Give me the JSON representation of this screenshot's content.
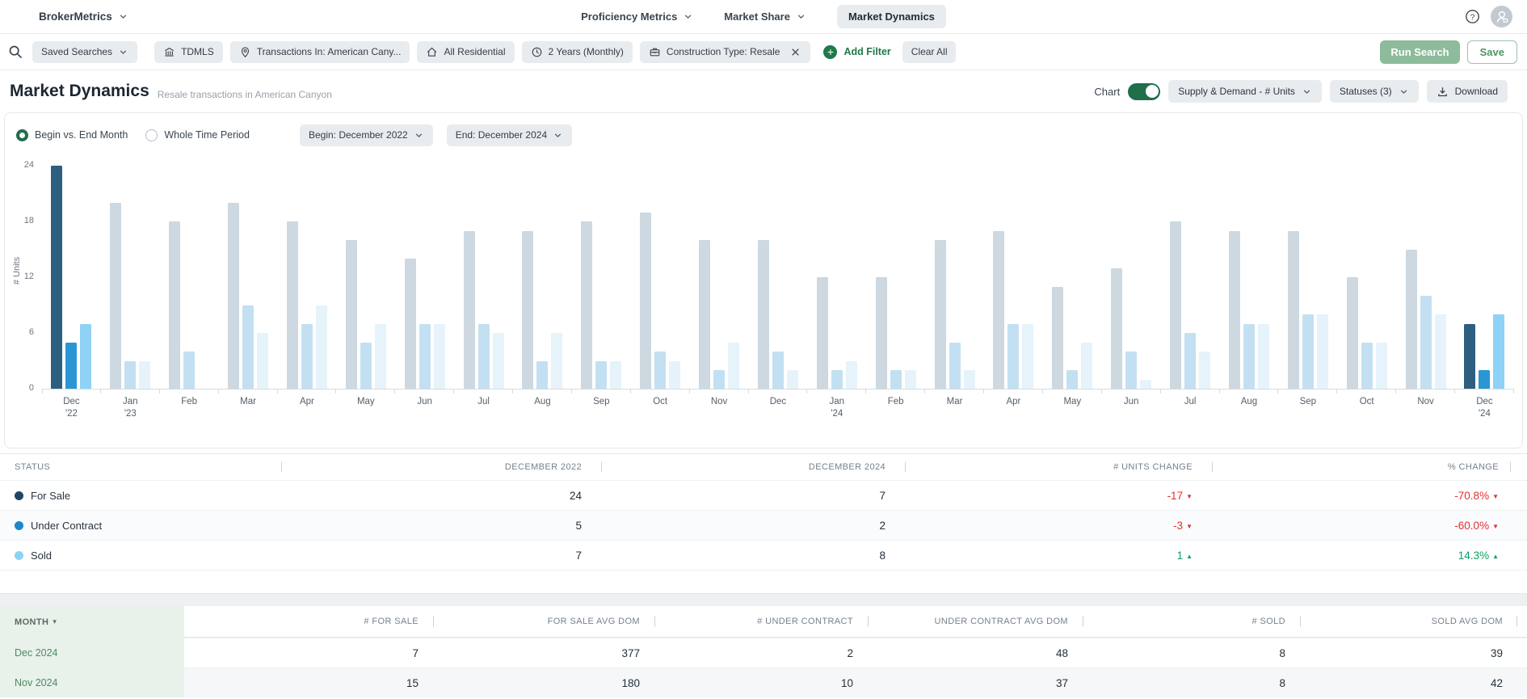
{
  "colors": {
    "accent_green": "#1f6f4a",
    "negative_red": "#e03131",
    "positive_green": "#0a9f63",
    "bar_for_sale": "#2d5f80",
    "bar_under_contract": "#2a96d3",
    "bar_sold": "#8ed2f7",
    "bar_for_sale_muted": "#cdd8e0",
    "bar_under_contract_muted": "#c3e0f2",
    "bar_sold_muted": "#e6f3fb"
  },
  "nav": {
    "brand": "BrokerMetrics",
    "menu_proficiency": "Proficiency Metrics",
    "menu_market_share": "Market Share",
    "tab_market_dynamics": "Market Dynamics"
  },
  "filter_bar": {
    "chips": [
      {
        "label": "Saved Searches",
        "icon": null,
        "chevron": true,
        "closable": false
      },
      {
        "label": "TDMLS",
        "icon": "bank-icon",
        "chevron": false,
        "closable": false
      },
      {
        "label": "Transactions In: American Cany...",
        "icon": "location-pin-icon",
        "chevron": false,
        "closable": false
      },
      {
        "label": "All Residential",
        "icon": "home-icon",
        "chevron": false,
        "closable": false
      },
      {
        "label": "2 Years (Monthly)",
        "icon": "clock-icon",
        "chevron": false,
        "closable": false
      },
      {
        "label": "Construction Type: Resale",
        "icon": "construction-type-icon",
        "chevron": false,
        "closable": true
      }
    ],
    "add_filter_label": "Add Filter",
    "clear_all_label": "Clear All",
    "run_search_label": "Run Search",
    "save_label": "Save"
  },
  "header": {
    "title": "Market Dynamics",
    "subtitle": "Resale transactions in American Canyon",
    "chart_toggle_label": "Chart",
    "metric_dropdown": "Supply & Demand - # Units",
    "statuses_dropdown": "Statuses (3)",
    "download_label": "Download"
  },
  "controls": {
    "radio_begin_end": "Begin vs. End Month",
    "radio_whole": "Whole Time Period",
    "begin_dropdown": "Begin: December 2022",
    "end_dropdown": "End: December 2024"
  },
  "chart_data": {
    "type": "bar",
    "title": "Supply & Demand - # Units",
    "xlabel": "",
    "ylabel": "# Units",
    "ylim": [
      0,
      24
    ],
    "yticks": [
      0,
      6,
      12,
      18,
      24
    ],
    "grid": false,
    "legend_position": "none",
    "categories": [
      [
        "Dec",
        "'22"
      ],
      [
        "Jan",
        "'23"
      ],
      [
        "Feb",
        ""
      ],
      [
        "Mar",
        ""
      ],
      [
        "Apr",
        ""
      ],
      [
        "May",
        ""
      ],
      [
        "Jun",
        ""
      ],
      [
        "Jul",
        ""
      ],
      [
        "Aug",
        ""
      ],
      [
        "Sep",
        ""
      ],
      [
        "Oct",
        ""
      ],
      [
        "Nov",
        ""
      ],
      [
        "Dec",
        ""
      ],
      [
        "Jan",
        "'24"
      ],
      [
        "Feb",
        ""
      ],
      [
        "Mar",
        ""
      ],
      [
        "Apr",
        ""
      ],
      [
        "May",
        ""
      ],
      [
        "Jun",
        ""
      ],
      [
        "Jul",
        ""
      ],
      [
        "Aug",
        ""
      ],
      [
        "Sep",
        ""
      ],
      [
        "Oct",
        ""
      ],
      [
        "Nov",
        ""
      ],
      [
        "Dec",
        "'24"
      ]
    ],
    "series": [
      {
        "name": "For Sale",
        "values": [
          24,
          20,
          18,
          20,
          18,
          16,
          14,
          17,
          17,
          18,
          19,
          16,
          16,
          12,
          12,
          16,
          17,
          11,
          13,
          18,
          17,
          17,
          12,
          15,
          7
        ]
      },
      {
        "name": "Under Contract",
        "values": [
          5,
          3,
          4,
          9,
          7,
          5,
          7,
          7,
          3,
          3,
          4,
          2,
          4,
          2,
          2,
          5,
          7,
          2,
          4,
          6,
          7,
          8,
          5,
          10,
          2
        ]
      },
      {
        "name": "Sold",
        "values": [
          7,
          3,
          0,
          6,
          9,
          7,
          7,
          6,
          6,
          3,
          3,
          5,
          2,
          3,
          2,
          2,
          7,
          5,
          1,
          4,
          7,
          8,
          5,
          8,
          8
        ]
      }
    ],
    "highlight_indices": [
      0,
      24
    ]
  },
  "status_table": {
    "headers": [
      "STATUS",
      "DECEMBER 2022",
      "DECEMBER 2024",
      "# UNITS CHANGE",
      "% CHANGE"
    ],
    "rows": [
      {
        "label": "For Sale",
        "dot_color": "#1d4566",
        "dec_2022": "24",
        "dec_2024": "7",
        "units_change": "-17",
        "units_dir": "down",
        "pct_change": "-70.8%",
        "pct_dir": "down"
      },
      {
        "label": "Under Contract",
        "dot_color": "#1d87c9",
        "dec_2022": "5",
        "dec_2024": "2",
        "units_change": "-3",
        "units_dir": "down",
        "pct_change": "-60.0%",
        "pct_dir": "down"
      },
      {
        "label": "Sold",
        "dot_color": "#8ed2f7",
        "dec_2022": "7",
        "dec_2024": "8",
        "units_change": "1",
        "units_dir": "up",
        "pct_change": "14.3%",
        "pct_dir": "up"
      }
    ]
  },
  "month_table": {
    "headers": [
      "MONTH",
      "# FOR SALE",
      "FOR SALE AVG DOM",
      "# UNDER CONTRACT",
      "UNDER CONTRACT AVG DOM",
      "# SOLD",
      "SOLD AVG DOM"
    ],
    "rows": [
      {
        "month": "Dec 2024",
        "values": [
          "7",
          "377",
          "2",
          "48",
          "8",
          "39"
        ]
      },
      {
        "month": "Nov 2024",
        "values": [
          "15",
          "180",
          "10",
          "37",
          "8",
          "42"
        ]
      }
    ]
  }
}
